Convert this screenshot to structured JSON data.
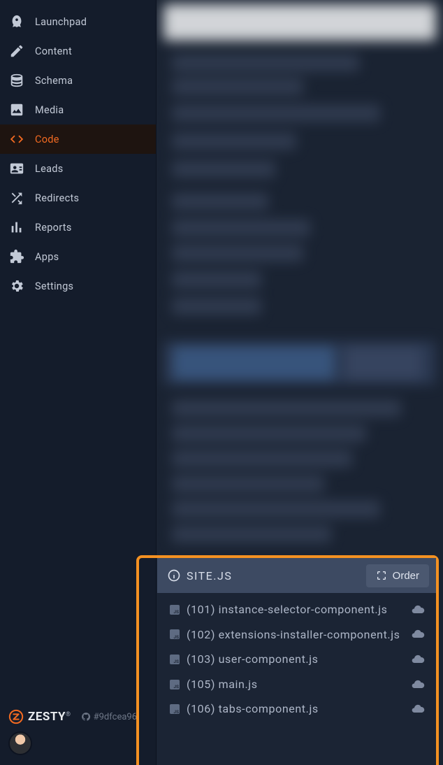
{
  "sidebar": {
    "items": [
      {
        "id": "launchpad",
        "label": "Launchpad"
      },
      {
        "id": "content",
        "label": "Content"
      },
      {
        "id": "schema",
        "label": "Schema"
      },
      {
        "id": "media",
        "label": "Media"
      },
      {
        "id": "code",
        "label": "Code"
      },
      {
        "id": "leads",
        "label": "Leads"
      },
      {
        "id": "redirects",
        "label": "Redirects"
      },
      {
        "id": "reports",
        "label": "Reports"
      },
      {
        "id": "apps",
        "label": "Apps"
      },
      {
        "id": "settings",
        "label": "Settings"
      }
    ],
    "active_index": 4
  },
  "footer": {
    "brand": "ZESTY",
    "hash": "#9dfcea96"
  },
  "panel": {
    "title": "SITE.JS",
    "order_label": "Order",
    "files": [
      {
        "order": "101",
        "name": "instance-selector-component.js"
      },
      {
        "order": "102",
        "name": "extensions-installer-component.js"
      },
      {
        "order": "103",
        "name": "user-component.js"
      },
      {
        "order": "105",
        "name": "main.js"
      },
      {
        "order": "106",
        "name": "tabs-component.js"
      }
    ]
  },
  "colors": {
    "accent": "#f26a21",
    "highlight_border": "#f49122"
  }
}
